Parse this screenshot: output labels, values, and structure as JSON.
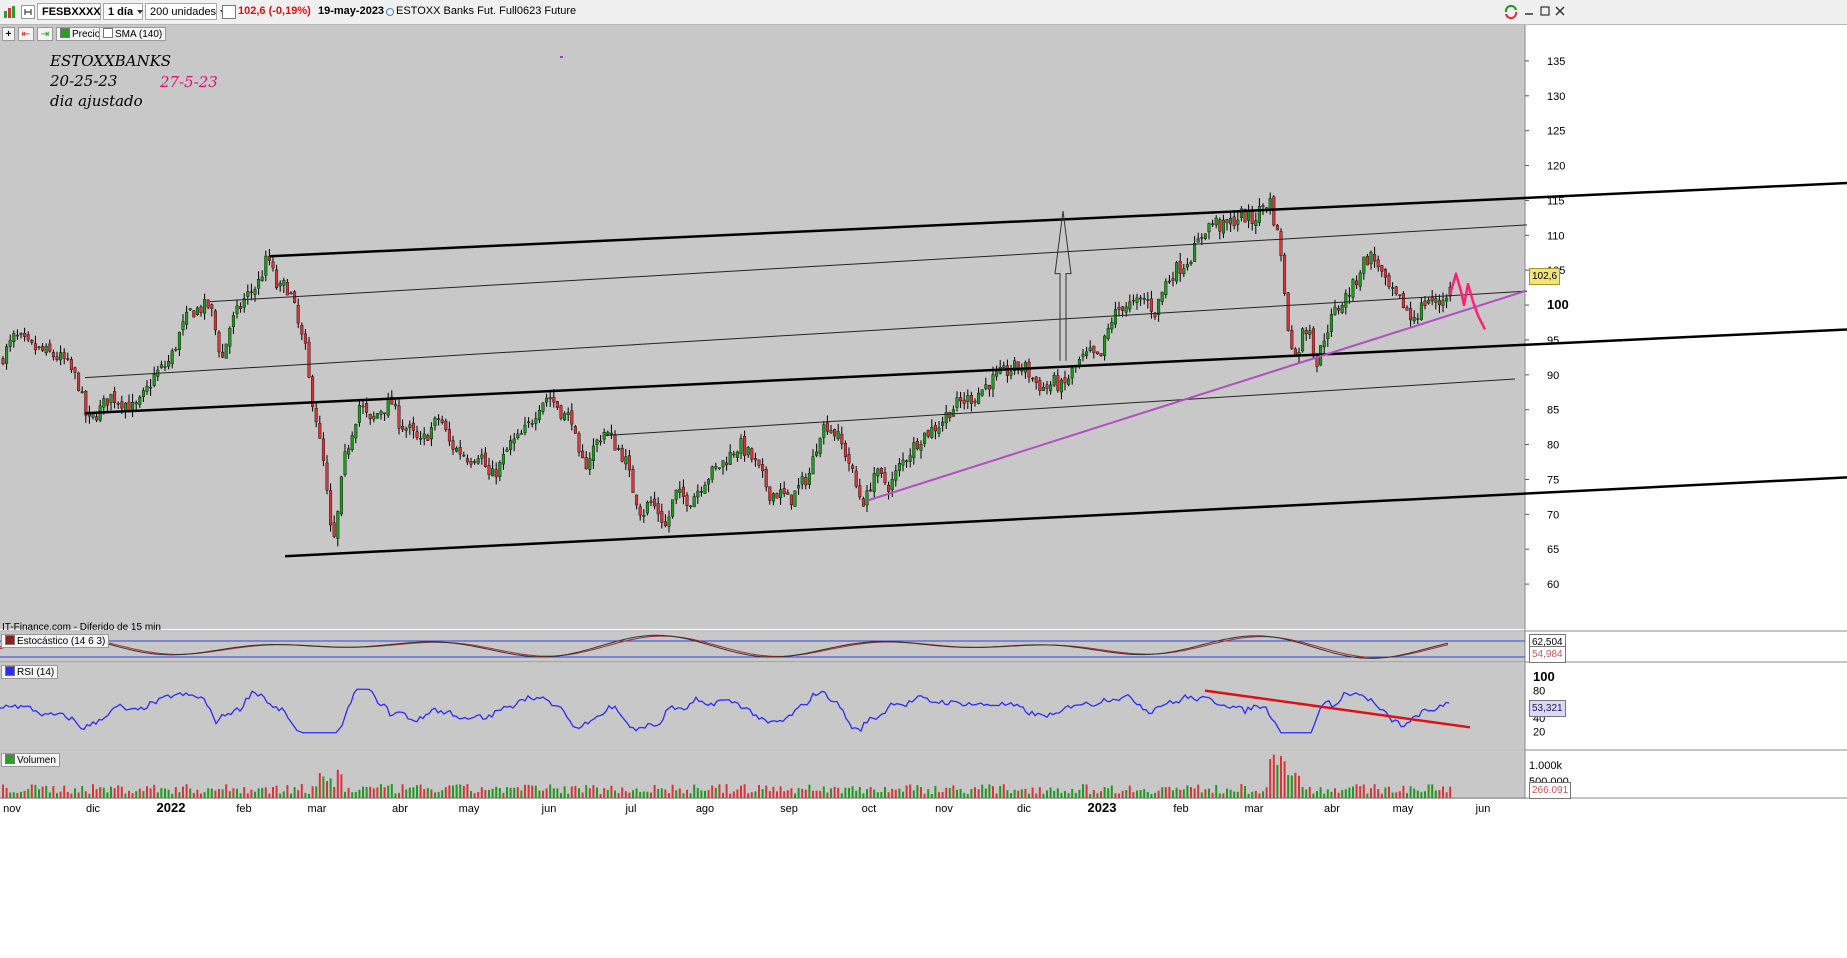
{
  "toolbar": {
    "symbol": "FESBXXXX",
    "period": "1 día",
    "units": "200 unidades",
    "last_change": "102,6 (-0,19%)",
    "date": "19-may-2023",
    "description": "ESTOXX Banks Fut. Full0623 Future"
  },
  "legend": {
    "price_label": "Precio",
    "sma_label": "SMA (140)"
  },
  "annotations": {
    "line1": "ESTOXXBANKS",
    "line2": "20-25-23",
    "line3": "dia ajustado",
    "date_red": "27-5-23"
  },
  "source_note": "IT-Finance.com - Diferido de 15 min",
  "colors": {
    "background": "#c8c8c8",
    "up_candle": "#1f9a1f",
    "down_candle": "#d9343a",
    "channel": "#000000",
    "trendline_purple": "#b04fbf",
    "projection_pink": "#ff1f7a",
    "rsi_line": "#2b2bff",
    "rsi_trendline": "#e01010"
  },
  "chart_data": [
    {
      "type": "candlestick",
      "name": "Precio",
      "y_ticks": [
        "135",
        "130",
        "125",
        "120",
        "115",
        "110",
        "105",
        "100",
        "95",
        "90",
        "85",
        "80",
        "75",
        "70",
        "65",
        "60"
      ],
      "ylim": [
        56,
        138
      ],
      "x_labels": [
        "nov",
        "dic",
        "2022",
        "feb",
        "mar",
        "abr",
        "may",
        "jun",
        "jul",
        "ago",
        "sep",
        "oct",
        "nov",
        "dic",
        "2023",
        "feb",
        "mar",
        "abr",
        "may",
        "jun"
      ],
      "last_price": "102,6",
      "price_path": [
        [
          0,
          92
        ],
        [
          15,
          95.5
        ],
        [
          30,
          94
        ],
        [
          50,
          93
        ],
        [
          65,
          92
        ],
        [
          78,
          89
        ],
        [
          88,
          83
        ],
        [
          100,
          85
        ],
        [
          110,
          87
        ],
        [
          125,
          86
        ],
        [
          135,
          85
        ],
        [
          140,
          86
        ],
        [
          155,
          90
        ],
        [
          170,
          92
        ],
        [
          180,
          96
        ],
        [
          190,
          99
        ],
        [
          200,
          99.5
        ],
        [
          210,
          100
        ],
        [
          222,
          92
        ],
        [
          230,
          97
        ],
        [
          245,
          101
        ],
        [
          258,
          103
        ],
        [
          268,
          107
        ],
        [
          278,
          102
        ],
        [
          286,
          103
        ],
        [
          292,
          101
        ],
        [
          300,
          96
        ],
        [
          305,
          94
        ],
        [
          310,
          88
        ],
        [
          315,
          85
        ],
        [
          320,
          80
        ],
        [
          325,
          76
        ],
        [
          330,
          68
        ],
        [
          335,
          66
        ],
        [
          340,
          73
        ],
        [
          345,
          78
        ],
        [
          352,
          82
        ],
        [
          360,
          86
        ],
        [
          370,
          83
        ],
        [
          380,
          85
        ],
        [
          392,
          86
        ],
        [
          400,
          83
        ],
        [
          410,
          82
        ],
        [
          420,
          80
        ],
        [
          430,
          82
        ],
        [
          440,
          84
        ],
        [
          450,
          80
        ],
        [
          460,
          79
        ],
        [
          470,
          78
        ],
        [
          480,
          79
        ],
        [
          490,
          75
        ],
        [
          500,
          77
        ],
        [
          510,
          80
        ],
        [
          520,
          81
        ],
        [
          530,
          83
        ],
        [
          540,
          86
        ],
        [
          548,
          87
        ],
        [
          555,
          86
        ],
        [
          565,
          84
        ],
        [
          572,
          84
        ],
        [
          578,
          78
        ],
        [
          585,
          77
        ],
        [
          595,
          80
        ],
        [
          605,
          82
        ],
        [
          615,
          80
        ],
        [
          625,
          78
        ],
        [
          632,
          74
        ],
        [
          642,
          70
        ],
        [
          650,
          72
        ],
        [
          660,
          70
        ],
        [
          666,
          68
        ],
        [
          675,
          73
        ],
        [
          690,
          72
        ],
        [
          705,
          75
        ],
        [
          720,
          77
        ],
        [
          740,
          80
        ],
        [
          752,
          78
        ],
        [
          760,
          76
        ],
        [
          770,
          73
        ],
        [
          780,
          73
        ],
        [
          790,
          72
        ],
        [
          800,
          74
        ],
        [
          810,
          76
        ],
        [
          820,
          82
        ],
        [
          828,
          83
        ],
        [
          838,
          81
        ],
        [
          848,
          78
        ],
        [
          856,
          74
        ],
        [
          862,
          72
        ],
        [
          866,
          72
        ],
        [
          874,
          76
        ],
        [
          882,
          75
        ],
        [
          890,
          74
        ],
        [
          900,
          77
        ],
        [
          910,
          79
        ],
        [
          920,
          81
        ],
        [
          930,
          82
        ],
        [
          940,
          83
        ],
        [
          950,
          85
        ],
        [
          960,
          86
        ],
        [
          975,
          87
        ],
        [
          990,
          89
        ],
        [
          1000,
          90
        ],
        [
          1015,
          91
        ],
        [
          1025,
          91
        ],
        [
          1035,
          89
        ],
        [
          1045,
          88
        ],
        [
          1055,
          89
        ],
        [
          1063,
          88
        ],
        [
          1070,
          90
        ],
        [
          1080,
          92
        ],
        [
          1090,
          93
        ],
        [
          1100,
          92
        ],
        [
          1105,
          95
        ],
        [
          1112,
          98
        ],
        [
          1122,
          100
        ],
        [
          1135,
          100
        ],
        [
          1145,
          101
        ],
        [
          1155,
          99
        ],
        [
          1165,
          103
        ],
        [
          1175,
          105
        ],
        [
          1185,
          106
        ],
        [
          1195,
          108
        ],
        [
          1205,
          111
        ],
        [
          1215,
          112
        ],
        [
          1222,
          111
        ],
        [
          1232,
          112
        ],
        [
          1242,
          113
        ],
        [
          1252,
          112
        ],
        [
          1262,
          114
        ],
        [
          1270,
          115
        ],
        [
          1276,
          111
        ],
        [
          1282,
          107
        ],
        [
          1286,
          98
        ],
        [
          1290,
          96
        ],
        [
          1296,
          92
        ],
        [
          1302,
          96
        ],
        [
          1310,
          97
        ],
        [
          1316,
          91
        ],
        [
          1325,
          96
        ],
        [
          1335,
          99
        ],
        [
          1345,
          101
        ],
        [
          1355,
          103
        ],
        [
          1362,
          106
        ],
        [
          1370,
          107
        ],
        [
          1378,
          106
        ],
        [
          1385,
          103
        ],
        [
          1395,
          101
        ],
        [
          1405,
          100
        ],
        [
          1410,
          98
        ],
        [
          1418,
          99
        ],
        [
          1428,
          101
        ],
        [
          1438,
          100
        ],
        [
          1448,
          102
        ],
        [
          1452,
          102.6
        ]
      ]
    },
    {
      "type": "line",
      "name": "Estocástico (14 6 3)",
      "values_shown": [
        "62,504",
        "54,984"
      ]
    },
    {
      "type": "line",
      "name": "RSI (14)",
      "y_ticks": [
        "100",
        "80",
        "60",
        "40",
        "20"
      ],
      "ylim": [
        0,
        100
      ],
      "last_value": "53,321"
    },
    {
      "type": "bar",
      "name": "Volumen",
      "y_ticks": [
        "1.000k",
        "500.000"
      ],
      "last_value": "266.091"
    }
  ]
}
